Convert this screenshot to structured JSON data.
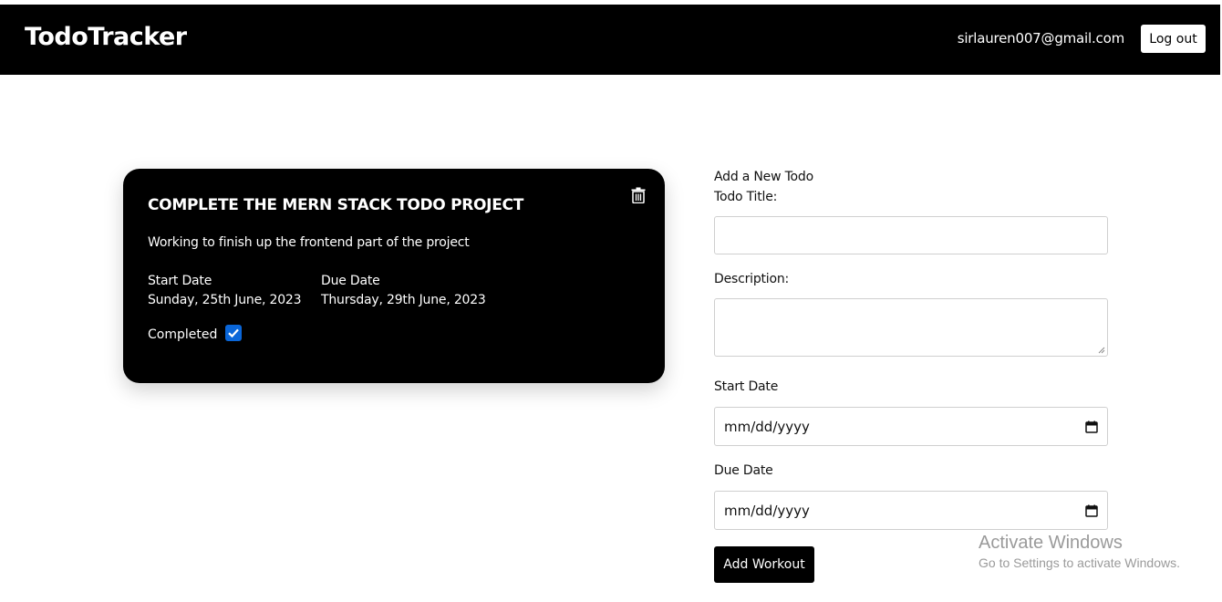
{
  "header": {
    "brand": "TodoTracker",
    "user_email": "sirlauren007@gmail.com",
    "logout_label": "Log out"
  },
  "todo": {
    "title": "COMPLETE THE MERN STACK TODO PROJECT",
    "description": "Working to finish up the frontend part of the project",
    "start_label": "Start Date",
    "start_value": "Sunday, 25th June, 2023",
    "due_label": "Due Date",
    "due_value": "Thursday, 29th June, 2023",
    "completed_label": "Completed",
    "completed": true,
    "delete_icon": "trash-icon"
  },
  "form": {
    "heading": "Add a New Todo",
    "title_label": "Todo Title:",
    "title_value": "",
    "description_label": "Description:",
    "description_value": "",
    "start_label": "Start Date",
    "start_placeholder": "mm/dd/yyyy",
    "due_label": "Due Date",
    "due_placeholder": "mm/dd/yyyy",
    "submit_label": "Add Workout"
  },
  "watermark": {
    "title": "Activate Windows",
    "subtitle": "Go to Settings to activate Windows."
  },
  "colors": {
    "header_bg": "#000000",
    "card_bg": "#000000",
    "checkbox": "#0a66d8",
    "button_bg": "#000000"
  }
}
